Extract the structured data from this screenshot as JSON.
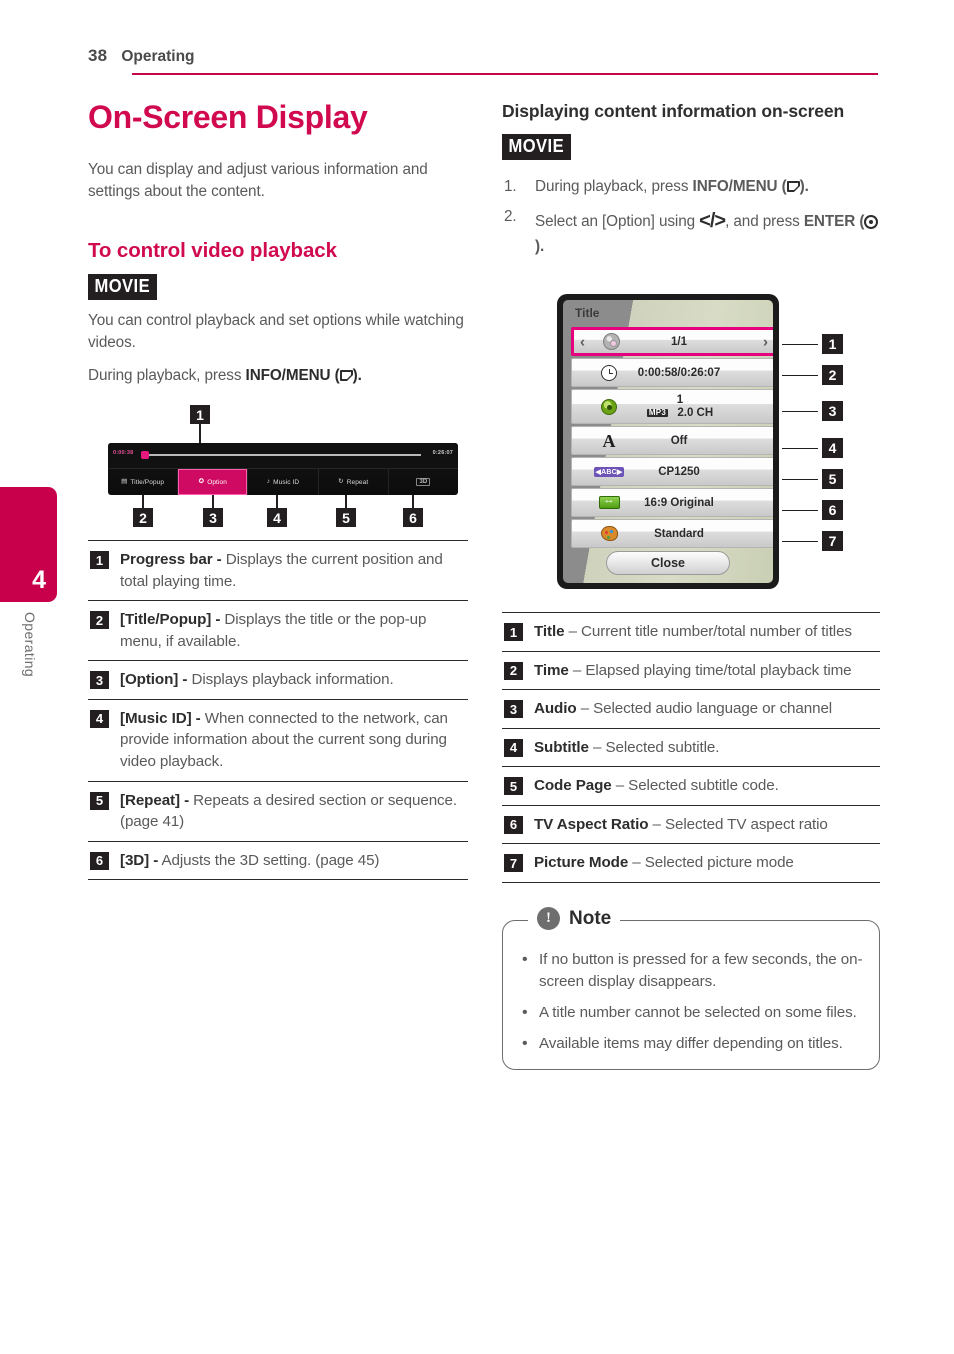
{
  "header": {
    "page_number": "38",
    "section": "Operating"
  },
  "chapter_tab": {
    "number": "4",
    "label": "Operating"
  },
  "left_column": {
    "title": "On-Screen Display",
    "intro": "You can display and adjust various information and settings about the content.",
    "subheading": "To control video playback",
    "badge": "MOVIE",
    "para1": "You can control playback and set options while watching videos.",
    "para2_prefix": "During playback, press ",
    "para2_bold": "INFO/MENU (",
    "para2_suffix": ").",
    "control_bar": {
      "elapsed_time": "0:00:38",
      "total_time": "0:26:07",
      "callout_top": "1",
      "buttons": [
        {
          "icon": "list-icon",
          "label": "Title/Popup",
          "callout": "2",
          "active": false
        },
        {
          "icon": "gear-icon",
          "label": "Option",
          "callout": "3",
          "active": true
        },
        {
          "icon": "music-note-icon",
          "label": "Music ID",
          "callout": "4",
          "active": false
        },
        {
          "icon": "repeat-icon",
          "label": "Repeat",
          "callout": "5",
          "active": false
        },
        {
          "icon": "3d-icon",
          "label": "3D",
          "callout": "6",
          "active": false
        }
      ]
    },
    "definitions": [
      {
        "num": "1",
        "term": "Progress bar -",
        "desc": " Displays the current position and total playing time."
      },
      {
        "num": "2",
        "term": "[Title/Popup] -",
        "desc": " Displays the title or the pop-up menu, if available."
      },
      {
        "num": "3",
        "term": "[Option] -",
        "desc": " Displays playback information."
      },
      {
        "num": "4",
        "term": "[Music ID] -",
        "desc": " When connected to the network, can provide information about the current song during video playback."
      },
      {
        "num": "5",
        "term": "[Repeat] -",
        "desc": " Repeats a desired section or sequence. (page 41)"
      },
      {
        "num": "6",
        "term": "[3D] -",
        "desc": " Adjusts the 3D setting. (page 45)"
      }
    ]
  },
  "right_column": {
    "subheading": "Displaying content information on-screen",
    "badge": "MOVIE",
    "steps": [
      {
        "n": "1.",
        "prefix": "During playback, press ",
        "bold": "INFO/MENU (",
        "suffix": ")."
      },
      {
        "n": "2.",
        "prefix": "Select an [Option] using ",
        "arrows": "</>",
        "mid": ", and press ",
        "bold": "ENTER (",
        "suffix": ")."
      }
    ],
    "osd": {
      "panel_title": "Title",
      "rows": [
        {
          "icon": "disc-icon",
          "value": "1/1",
          "callout": "1",
          "selected": true,
          "left_arrow": "‹",
          "right_arrow": "›"
        },
        {
          "icon": "clock-icon",
          "value": "0:00:58/0:26:07",
          "callout": "2",
          "selected": false
        },
        {
          "icon": "audio-disc-icon",
          "value_line1": "1",
          "value_tag": "MP3",
          "value_line2": "2.0 CH",
          "callout": "3",
          "selected": false
        },
        {
          "icon": "subtitle-A-icon",
          "value": "Off",
          "callout": "4",
          "selected": false
        },
        {
          "icon": "code-page-abc-icon",
          "value": "CP1250",
          "callout": "5",
          "selected": false
        },
        {
          "icon": "aspect-ratio-icon",
          "value": "16:9 Original",
          "callout": "6",
          "selected": false
        },
        {
          "icon": "palette-icon",
          "value": "Standard",
          "callout": "7",
          "selected": false
        }
      ],
      "close_label": "Close"
    },
    "definitions": [
      {
        "num": "1",
        "term": "Title",
        "desc": " – Current title number/total number of titles"
      },
      {
        "num": "2",
        "term": "Time",
        "desc": " – Elapsed playing time/total playback time"
      },
      {
        "num": "3",
        "term": "Audio",
        "desc": " – Selected audio language or channel"
      },
      {
        "num": "4",
        "term": "Subtitle",
        "desc": " – Selected subtitle."
      },
      {
        "num": "5",
        "term": "Code Page",
        "desc": " – Selected subtitle code."
      },
      {
        "num": "6",
        "term": "TV Aspect Ratio",
        "desc": " – Selected TV aspect ratio"
      },
      {
        "num": "7",
        "term": "Picture Mode",
        "desc": " – Selected picture mode"
      }
    ],
    "note": {
      "icon": "exclamation-icon",
      "title": "Note",
      "items": [
        "If no button is pressed for a few seconds, the on-screen display disappears.",
        "A title number cannot be selected on some files.",
        "Available items may differ depending on titles."
      ]
    }
  },
  "colors": {
    "accent": "#d10a50",
    "tab": "#c8004b",
    "osd_select": "#e6007e",
    "ink": "#231f20"
  }
}
